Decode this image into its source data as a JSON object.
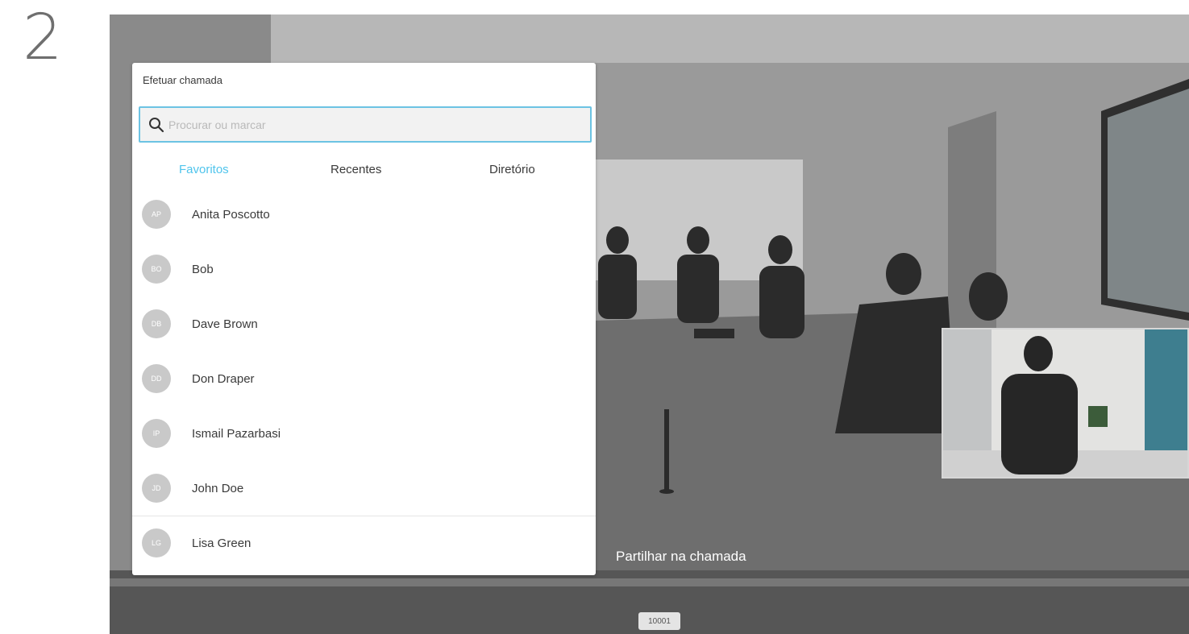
{
  "step": "2",
  "panel": {
    "title": "Efetuar chamada",
    "search_placeholder": "Procurar ou marcar",
    "tabs": [
      {
        "label": "Favoritos",
        "active": true
      },
      {
        "label": "Recentes",
        "active": false
      },
      {
        "label": "Diretório",
        "active": false
      }
    ],
    "contacts": [
      {
        "name": "Anita Poscotto",
        "initials": "AP"
      },
      {
        "name": "Bob",
        "initials": "BO"
      },
      {
        "name": "Dave Brown",
        "initials": "DB"
      },
      {
        "name": "Don Draper",
        "initials": "DD"
      },
      {
        "name": "Ismail Pazarbasi",
        "initials": "IP"
      },
      {
        "name": "John Doe",
        "initials": "JD"
      },
      {
        "name": "Lisa Green",
        "initials": "LG"
      }
    ]
  },
  "call": {
    "share_label": "Partilhar na chamada",
    "number": "10001"
  },
  "colors": {
    "accent": "#4fc4ec",
    "search_border": "#6cc3e3"
  }
}
